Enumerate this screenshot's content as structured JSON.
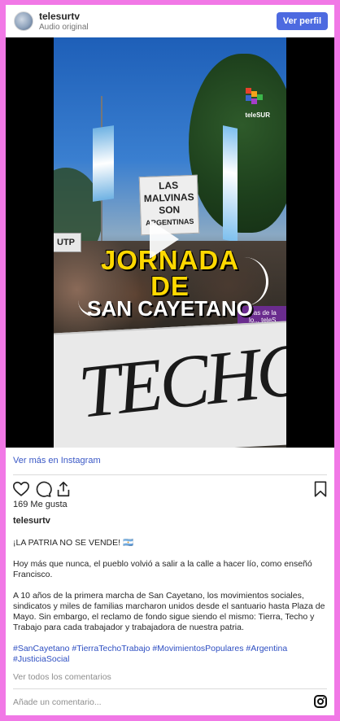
{
  "header": {
    "username": "telesurtv",
    "audio_label": "Audio original",
    "view_profile": "Ver perfil"
  },
  "media": {
    "sign_lines": [
      "LAS",
      "MALVINAS",
      "SON",
      "ARGENTINAS"
    ],
    "side_sign": "UTP",
    "overlay_line1": "JORNADA",
    "overlay_line2": "DE",
    "overlay_line3": "SAN CAYETANO",
    "banner_text": "TECHO y",
    "purple_sign": "Cas de la lo... teleS...",
    "logo_text": "teleSUR"
  },
  "see_more": "Ver más en Instagram",
  "likes": "169 Me gusta",
  "owner": "telesurtv",
  "caption": {
    "line1": "¡LA PATRIA NO SE VENDE! 🇦🇷",
    "para1": "Hoy más que nunca, el pueblo volvió a salir a la calle a hacer lío, como enseñó Francisco.",
    "para2": "A 10 años de la primera marcha de San Cayetano, los movimientos sociales, sindicatos y miles de familias marcharon unidos desde el santuario hasta Plaza de Mayo. Sin embargo, el reclamo de fondo sigue siendo el mismo: Tierra, Techo y Trabajo para cada trabajador y trabajadora de nuestra patria.",
    "hashtags": "#SanCayetano #TierraTechoTrabajo #MovimientosPopulares #Argentina #JusticiaSocial"
  },
  "view_comments": "Ver todos los comentarios",
  "add_comment_placeholder": "Añade un comentario...",
  "colors": {
    "frame": "#f178e6",
    "button": "#4d6ae0",
    "link": "#3a58c6",
    "hashtag": "#2e4fc2"
  }
}
